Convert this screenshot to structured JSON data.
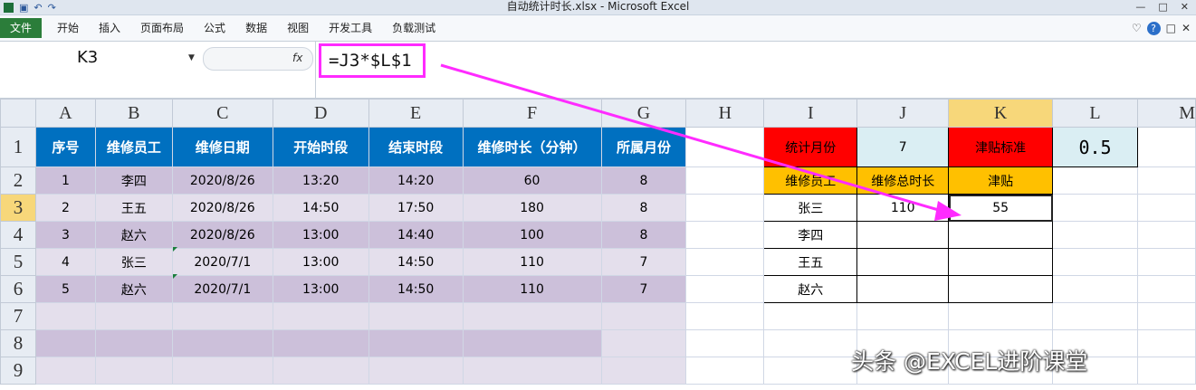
{
  "window": {
    "title": "自动统计时长.xlsx - Microsoft Excel"
  },
  "ribbon": {
    "file_tab": "文件",
    "tabs": [
      "开始",
      "插入",
      "页面布局",
      "公式",
      "数据",
      "视图",
      "开发工具",
      "负载测试"
    ]
  },
  "formula_bar": {
    "name_box": "K3",
    "fx_label": "fx",
    "formula": "=J3*$L$1"
  },
  "columns": [
    "A",
    "B",
    "C",
    "D",
    "E",
    "F",
    "G",
    "H",
    "I",
    "J",
    "K",
    "L",
    "M"
  ],
  "rows": [
    "1",
    "2",
    "3",
    "4",
    "5",
    "6",
    "7",
    "8",
    "9"
  ],
  "main_table": {
    "headers": [
      "序号",
      "维修员工",
      "维修日期",
      "开始时段",
      "结束时段",
      "维修时长（分钟）",
      "所属月份"
    ],
    "records": [
      [
        "1",
        "李四",
        "2020/8/26",
        "13:20",
        "14:20",
        "60",
        "8"
      ],
      [
        "2",
        "王五",
        "2020/8/26",
        "14:50",
        "17:50",
        "180",
        "8"
      ],
      [
        "3",
        "赵六",
        "2020/8/26",
        "13:00",
        "14:40",
        "100",
        "8"
      ],
      [
        "4",
        "张三",
        "2020/7/1",
        "13:00",
        "14:50",
        "110",
        "7"
      ],
      [
        "5",
        "赵六",
        "2020/7/1",
        "13:00",
        "14:50",
        "110",
        "7"
      ]
    ]
  },
  "summary": {
    "month_label": "统计月份",
    "month_value": "7",
    "rate_label": "津贴标准",
    "rate_value": "0.5",
    "col_employee": "维修员工",
    "col_total": "维修总时长",
    "col_allowance": "津贴",
    "employees": [
      "张三",
      "李四",
      "王五",
      "赵六"
    ],
    "totals": [
      "110",
      "",
      "",
      ""
    ],
    "allowances": [
      "55",
      "",
      "",
      ""
    ]
  },
  "watermark": "头条 @EXCEL进阶课堂",
  "colors": {
    "header_blue": "#0070c0",
    "lavender": "#ccc0da",
    "red": "#ff0000",
    "orange": "#ffc000",
    "light_blue": "#daeef3",
    "arrow": "#ff2bff"
  }
}
